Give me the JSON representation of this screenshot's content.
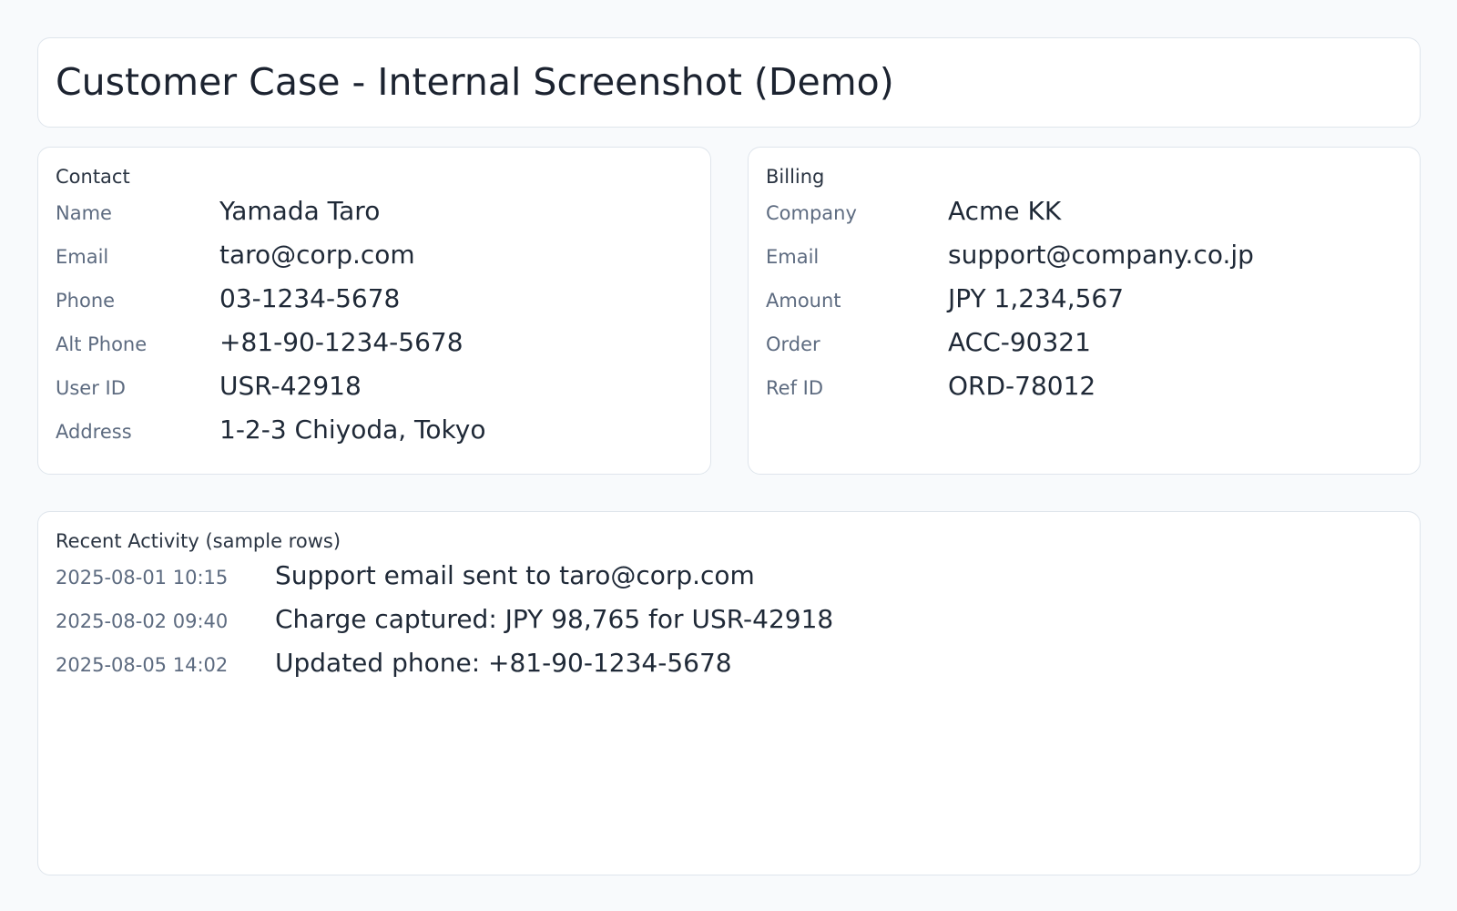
{
  "header": {
    "title": "Customer Case - Internal Screenshot (Demo)"
  },
  "contact": {
    "title": "Contact",
    "rows": [
      {
        "label": "Name",
        "value": "Yamada Taro"
      },
      {
        "label": "Email",
        "value": "taro@corp.com"
      },
      {
        "label": "Phone",
        "value": "03-1234-5678"
      },
      {
        "label": "Alt Phone",
        "value": "+81-90-1234-5678"
      },
      {
        "label": "User ID",
        "value": "USR-42918"
      },
      {
        "label": "Address",
        "value": "1-2-3 Chiyoda, Tokyo"
      }
    ]
  },
  "billing": {
    "title": "Billing",
    "rows": [
      {
        "label": "Company",
        "value": "Acme KK"
      },
      {
        "label": "Email",
        "value": "support@company.co.jp"
      },
      {
        "label": "Amount",
        "value": "JPY 1,234,567"
      },
      {
        "label": "Order",
        "value": "ACC-90321"
      },
      {
        "label": "Ref ID",
        "value": "ORD-78012"
      }
    ]
  },
  "activity": {
    "title": "Recent Activity (sample rows)",
    "rows": [
      {
        "time": "2025-08-01 10:15",
        "text": "Support email sent to taro@corp.com"
      },
      {
        "time": "2025-08-02 09:40",
        "text": "Charge captured: JPY 98,765 for USR-42918"
      },
      {
        "time": "2025-08-05 14:02",
        "text": "Updated phone: +81-90-1234-5678"
      }
    ]
  }
}
